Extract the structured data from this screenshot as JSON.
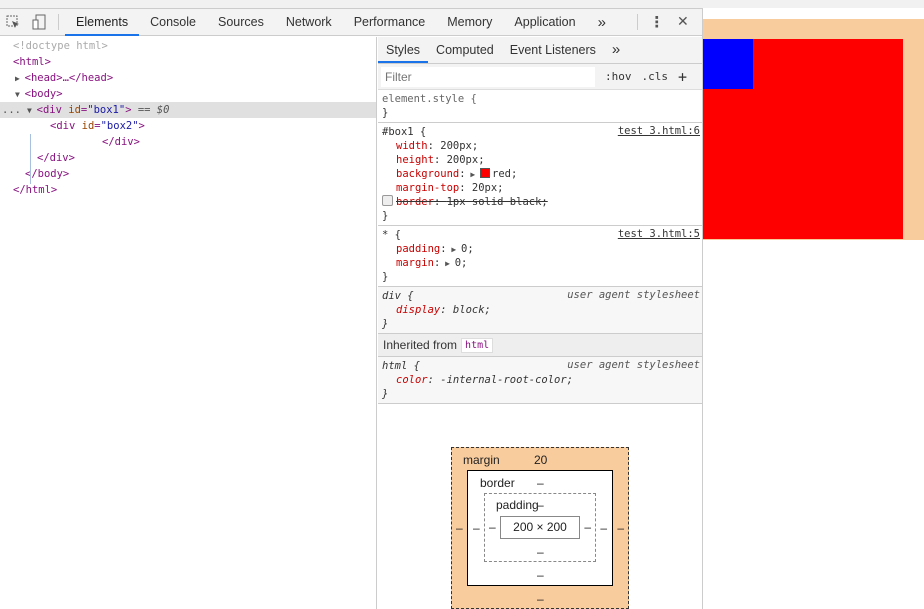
{
  "toolbar": {
    "tabs": [
      "Elements",
      "Console",
      "Sources",
      "Network",
      "Performance",
      "Memory",
      "Application"
    ],
    "active": "Elements",
    "more": "»",
    "menu": "⋮",
    "close": "✕"
  },
  "dom": {
    "doctype": "<!doctype html>",
    "html_open": "<html>",
    "head": "<head>…</head>",
    "body_open": "<body>",
    "div1_tag": "div",
    "div1_attr": "id",
    "div1_val": "\"box1\"",
    "selected_suffix": "== $0",
    "div2_tag": "div",
    "div2_attr": "id",
    "div2_val": "\"box2\"",
    "div2_close": "</div>",
    "div1_close": "</div>",
    "body_close": "</body>",
    "html_close": "</html>",
    "ellipsis": "..."
  },
  "styles": {
    "tabs": [
      "Styles",
      "Computed",
      "Event Listeners"
    ],
    "more": "»",
    "filter_placeholder": "Filter",
    "hov": ":hov",
    "cls": ".cls",
    "plus": "+",
    "element_style": "element.style {",
    "close": "}",
    "box1": {
      "selector": "#box1 {",
      "source": "test 3.html:6",
      "props": [
        [
          "width",
          "200px;"
        ],
        [
          "height",
          "200px;"
        ],
        [
          "background",
          "red;"
        ],
        [
          "margin-top",
          "20px;"
        ],
        [
          "border",
          "1px solid black;"
        ]
      ]
    },
    "star": {
      "selector": "* {",
      "source": "test 3.html:5",
      "props": [
        [
          "padding",
          "0;"
        ],
        [
          "margin",
          "0;"
        ]
      ]
    },
    "div": {
      "selector": "div {",
      "source": "user agent stylesheet",
      "props": [
        [
          "display",
          "block;"
        ]
      ]
    },
    "inherited_label": "Inherited from",
    "inherited_tag": "html",
    "html": {
      "selector": "html {",
      "source": "user agent stylesheet",
      "props": [
        [
          "color",
          "-internal-root-color;"
        ]
      ]
    }
  },
  "box_model": {
    "margin_label": "margin",
    "margin_top": "20",
    "border_label": "border",
    "padding_label": "padding",
    "content": "200 × 200",
    "dash": "–"
  },
  "colors": {
    "red": "#ff0000",
    "blue": "#0000ff",
    "margin_highlight": "#f9cc9d",
    "black": "#000000"
  }
}
